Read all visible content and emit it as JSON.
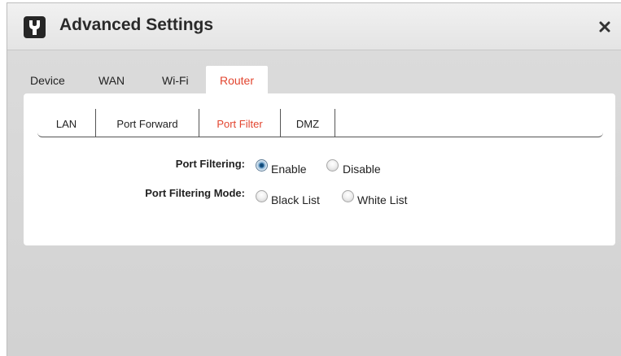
{
  "window": {
    "title": "Advanced Settings",
    "title_icon": "wrench-icon",
    "close_icon": "close-icon"
  },
  "main_tabs": [
    {
      "label": "Device",
      "active": false
    },
    {
      "label": "WAN",
      "active": false
    },
    {
      "label": "Wi-Fi",
      "active": false
    },
    {
      "label": "Router",
      "active": true
    }
  ],
  "sub_tabs": [
    {
      "label": "LAN",
      "active": false
    },
    {
      "label": "Port Forward",
      "active": false
    },
    {
      "label": "Port Filter",
      "active": true
    },
    {
      "label": "DMZ",
      "active": false
    }
  ],
  "form": {
    "port_filtering": {
      "label": "Port Filtering:",
      "options": [
        {
          "label": "Enable",
          "checked": true
        },
        {
          "label": "Disable",
          "checked": false
        }
      ]
    },
    "port_filtering_mode": {
      "label": "Port Filtering Mode:",
      "options": [
        {
          "label": "Black List",
          "checked": false
        },
        {
          "label": "White List",
          "checked": false
        }
      ]
    }
  },
  "colors": {
    "active_tab_text": "#e2452f",
    "background": "#d6d6d6",
    "panel": "#ffffff"
  }
}
